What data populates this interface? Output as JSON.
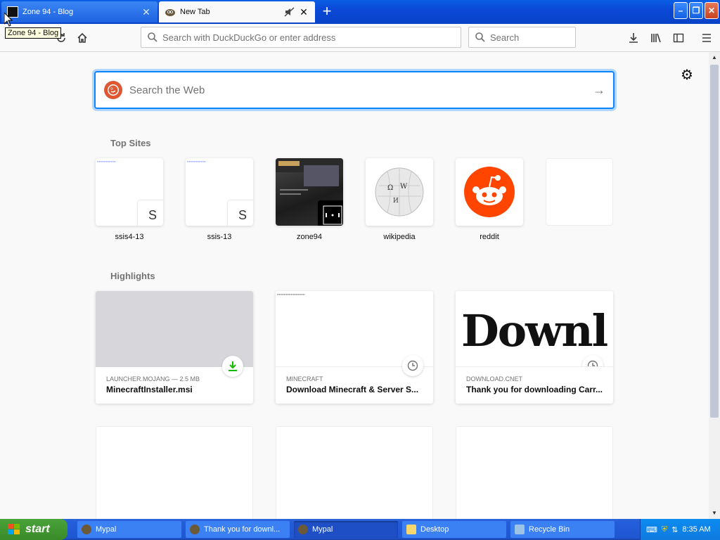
{
  "tabs": [
    {
      "title": "Zone 94 - Blog",
      "active": false
    },
    {
      "title": "New Tab",
      "active": true
    }
  ],
  "tooltip": "Zone 94 - Blog",
  "navbar": {
    "url_placeholder": "Search with DuckDuckGo or enter address",
    "search_placeholder": "Search"
  },
  "newtab": {
    "search_placeholder": "Search the Web",
    "top_sites_title": "Top Sites",
    "top_sites": [
      {
        "label": "ssis4-13",
        "letter": "S"
      },
      {
        "label": "ssis-13",
        "letter": "S"
      },
      {
        "label": "zone94",
        "letter": ""
      },
      {
        "label": "wikipedia",
        "letter": ""
      },
      {
        "label": "reddit",
        "letter": ""
      }
    ],
    "highlights_title": "Highlights",
    "highlights": [
      {
        "source": "LAUNCHER.MOJANG — 2.5 MB",
        "title": "MinecraftInstaller.msi",
        "badge": "download-icon"
      },
      {
        "source": "MINECRAFT",
        "title": "Download Minecraft & Server S...",
        "badge": "clock-icon"
      },
      {
        "source": "DOWNLOAD.CNET",
        "title": "Thank you for downloading Carr...",
        "badge": "clock-icon",
        "thumb_text": "Downl"
      }
    ]
  },
  "taskbar": {
    "start_label": "start",
    "items": [
      {
        "label": "Mypal",
        "active": false
      },
      {
        "label": "Thank you for downl...",
        "active": false
      },
      {
        "label": "Mypal",
        "active": true
      },
      {
        "label": "Desktop",
        "active": false
      },
      {
        "label": "Recycle Bin",
        "active": false
      }
    ],
    "clock": "8:35 AM"
  },
  "colors": {
    "accent": "#0a84ff",
    "reddit": "#ff4500",
    "ddg": "#de5833",
    "xp_blue": "#245edb"
  }
}
